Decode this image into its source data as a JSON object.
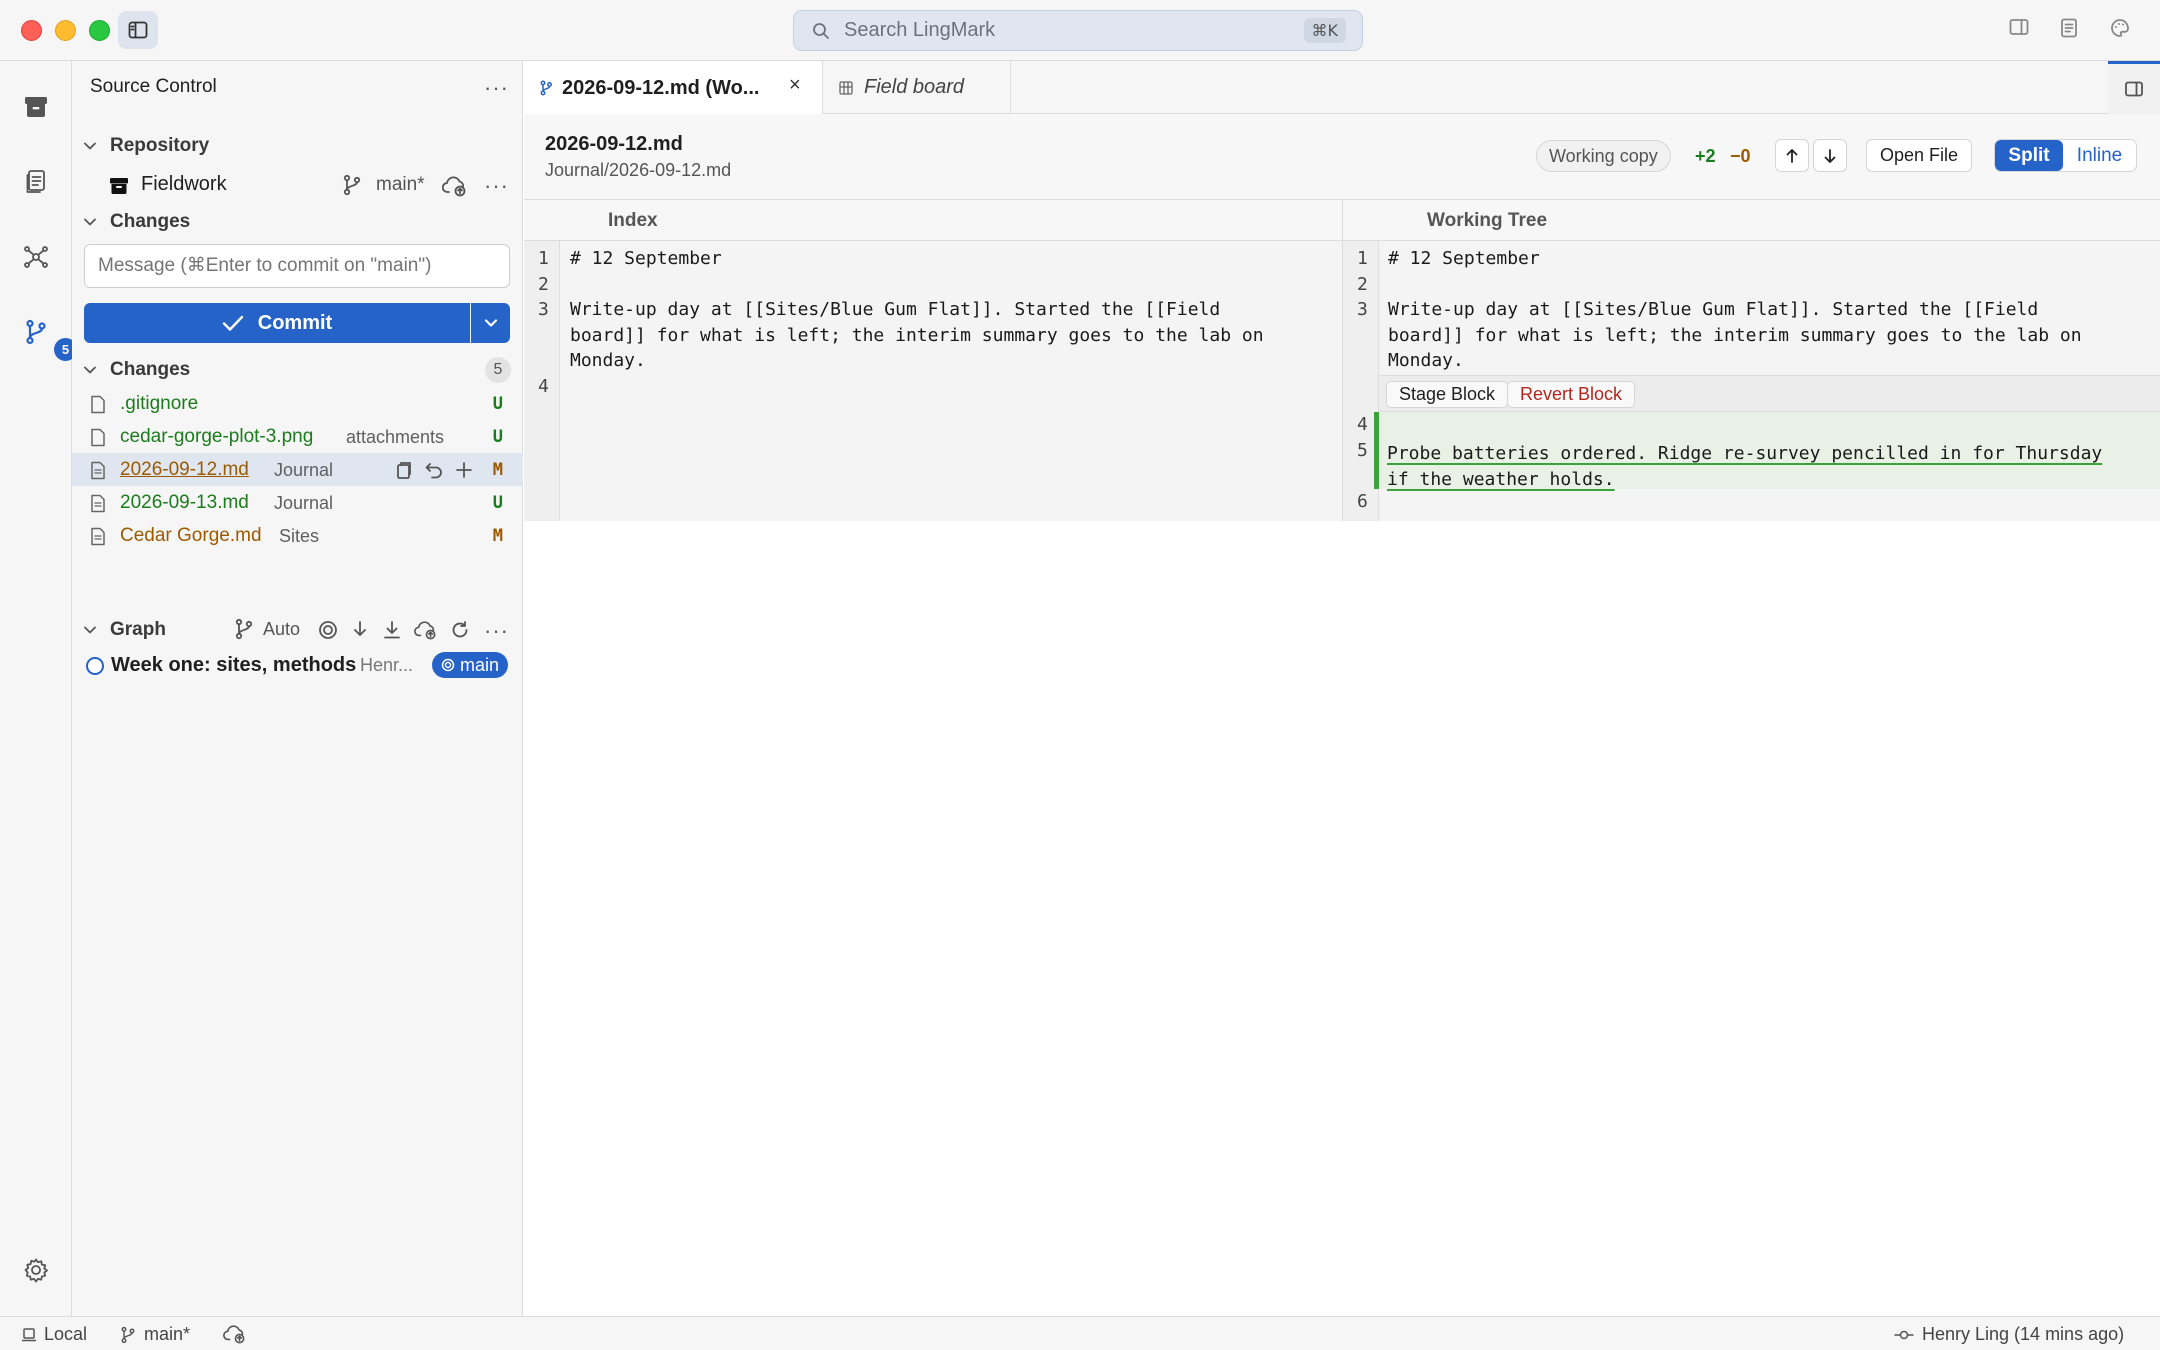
{
  "search": {
    "placeholder": "Search LingMark",
    "shortcut": "⌘K"
  },
  "activity": {
    "source_control_badge": "5"
  },
  "panel": {
    "title": "Source Control",
    "repository_section": "Repository",
    "repo_name": "Fieldwork",
    "branch": "main*",
    "changes_section": "Changes",
    "commit_placeholder": "Message (⌘Enter to commit on \"main\")",
    "commit_label": "Commit",
    "changes_list_section": "Changes",
    "changes_count": "5",
    "files": [
      {
        "name": ".gitignore",
        "dir": "",
        "status": "U"
      },
      {
        "name": "cedar-gorge-plot-3.png",
        "dir": "attachments",
        "status": "U"
      },
      {
        "name": "2026-09-12.md",
        "dir": "Journal",
        "status": "M"
      },
      {
        "name": "2026-09-13.md",
        "dir": "Journal",
        "status": "U"
      },
      {
        "name": "Cedar Gorge.md",
        "dir": "Sites",
        "status": "M"
      }
    ],
    "graph_section": "Graph",
    "graph_mode": "Auto",
    "commit_message": "Week one: sites, methods",
    "commit_author": "Henr...",
    "commit_branch": "main"
  },
  "tabs": [
    {
      "label": "2026-09-12.md (Wo..."
    },
    {
      "label": "Field board"
    }
  ],
  "diff": {
    "title": "2026-09-12.md",
    "path": "Journal/2026-09-12.md",
    "working_copy": "Working copy",
    "additions": "+2",
    "deletions": "−0",
    "open_file": "Open File",
    "split": "Split",
    "inline": "Inline",
    "left_header": "Index",
    "right_header": "Working Tree",
    "left_line1": "# 12 September",
    "left_line3": "Write-up day at [[Sites/Blue Gum Flat]]. Started the [[Field\nboard]] for what is left; the interim summary goes to the lab on\nMonday.",
    "right_line1": "# 12 September",
    "right_line3": "Write-up day at [[Sites/Blue Gum Flat]]. Started the [[Field\nboard]] for what is left; the interim summary goes to the lab on\nMonday.",
    "stage_block": "Stage Block",
    "revert_block": "Revert Block",
    "added_line_a": "Probe batteries ordered. Ridge re-survey pencilled in for Thursday",
    "added_line_b": "if the weather holds."
  },
  "status": {
    "location": "Local",
    "branch": "main*",
    "last_commit": "Henry Ling (14 mins ago)"
  }
}
